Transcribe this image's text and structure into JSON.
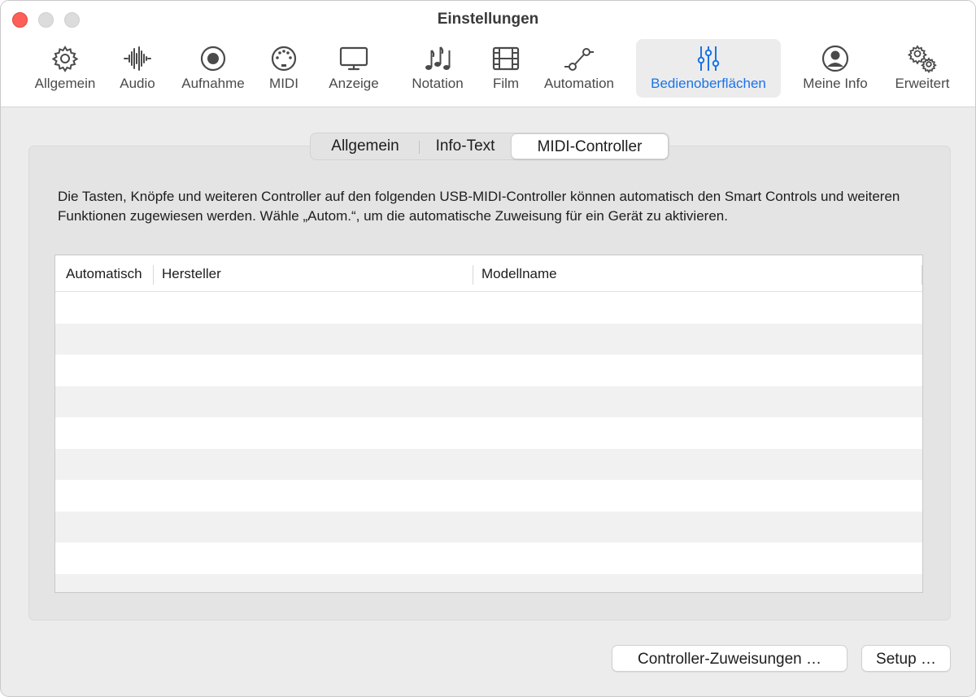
{
  "window": {
    "title": "Einstellungen"
  },
  "toolbar": {
    "items": [
      {
        "label": "Allgemein",
        "icon": "gear-icon"
      },
      {
        "label": "Audio",
        "icon": "waveform-icon"
      },
      {
        "label": "Aufnahme",
        "icon": "record-icon"
      },
      {
        "label": "MIDI",
        "icon": "midi-port-icon"
      },
      {
        "label": "Anzeige",
        "icon": "display-icon"
      },
      {
        "label": "Notation",
        "icon": "music-notes-icon"
      },
      {
        "label": "Film",
        "icon": "film-icon"
      },
      {
        "label": "Automation",
        "icon": "automation-icon"
      },
      {
        "label": "Bedienoberflächen",
        "icon": "sliders-icon",
        "active": true
      },
      {
        "label": "Meine Info",
        "icon": "person-circle-icon"
      },
      {
        "label": "Erweitert",
        "icon": "gears-icon"
      }
    ],
    "active_color": "#1a73e8"
  },
  "tabs": {
    "items": [
      "Allgemein",
      "Info-Text",
      "MIDI-Controller"
    ],
    "selected": "MIDI-Controller"
  },
  "description": "Die Tasten, Knöpfe und weiteren Controller auf den folgenden USB-MIDI-Controller können automatisch den Smart Controls und weiteren Funktionen zugewiesen werden. Wähle „Autom.“, um die automatische Zuweisung für ein Gerät zu aktivieren.",
  "table": {
    "columns": [
      "Automatisch",
      "Hersteller",
      "Modellname"
    ],
    "rows": []
  },
  "buttons": {
    "controller_assignments": "Controller-Zuweisungen …",
    "setup": "Setup …"
  }
}
